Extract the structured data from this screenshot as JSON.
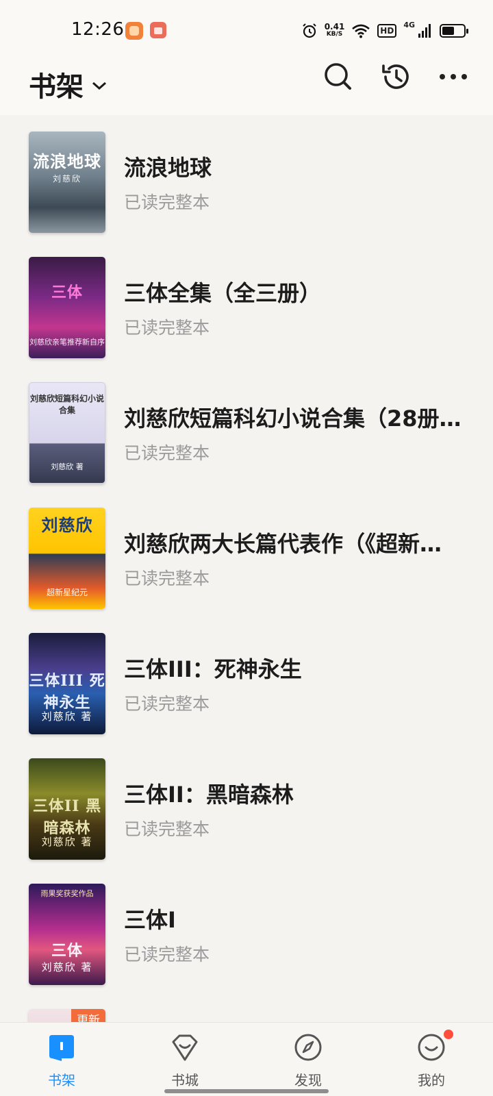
{
  "status_bar": {
    "time": "12:26",
    "net_speed_value": "0.41",
    "net_speed_unit": "KB/S",
    "hd_label": "HD",
    "network_type": "4G",
    "battery_level": 0.55
  },
  "header": {
    "title": "书架",
    "icons": [
      "search-icon",
      "history-icon",
      "more-icon"
    ]
  },
  "books": [
    {
      "title": "流浪地球",
      "status": "已读完整本",
      "cover_text": "流浪地球",
      "cover_author": "刘慈欣"
    },
    {
      "title": "三体全集（全三册）",
      "status": "已读完整本",
      "cover_text": "三体",
      "cover_author": "刘慈欣亲笔推荐新自序"
    },
    {
      "title": "刘慈欣短篇科幻小说合集（28册…",
      "status": "已读完整本",
      "cover_text": "刘慈欣短篇科幻小说合集",
      "cover_author": "刘慈欣 著"
    },
    {
      "title": "刘慈欣两大长篇代表作（《超新…",
      "status": "已读完整本",
      "cover_text": "刘慈欣",
      "cover_author": "超新星纪元"
    },
    {
      "title": "三体III：死神永生",
      "status": "已读完整本",
      "cover_text": "三体III 死神永生",
      "cover_author": "刘慈欣 著"
    },
    {
      "title": "三体II：黑暗森林",
      "status": "已读完整本",
      "cover_text": "三体II 黑暗森林",
      "cover_author": "刘慈欣 著"
    },
    {
      "title": "三体I",
      "status": "已读完整本",
      "cover_text": "三体",
      "cover_author": "刘慈欣 著",
      "cover_top": "雨果奖获奖作品"
    }
  ],
  "partial_book": {
    "tag": "更新"
  },
  "bottom_nav": [
    {
      "label": "书架",
      "icon": "bookshelf-icon",
      "active": true
    },
    {
      "label": "书城",
      "icon": "bookstore-icon",
      "active": false
    },
    {
      "label": "发现",
      "icon": "discover-compass-icon",
      "active": false
    },
    {
      "label": "我的",
      "icon": "profile-smile-icon",
      "active": false,
      "badge": true
    }
  ],
  "colors": {
    "accent": "#1890ff",
    "badge": "#ff4d3c",
    "update_tag": "#f26b3a",
    "background": "#f5f3f0"
  }
}
